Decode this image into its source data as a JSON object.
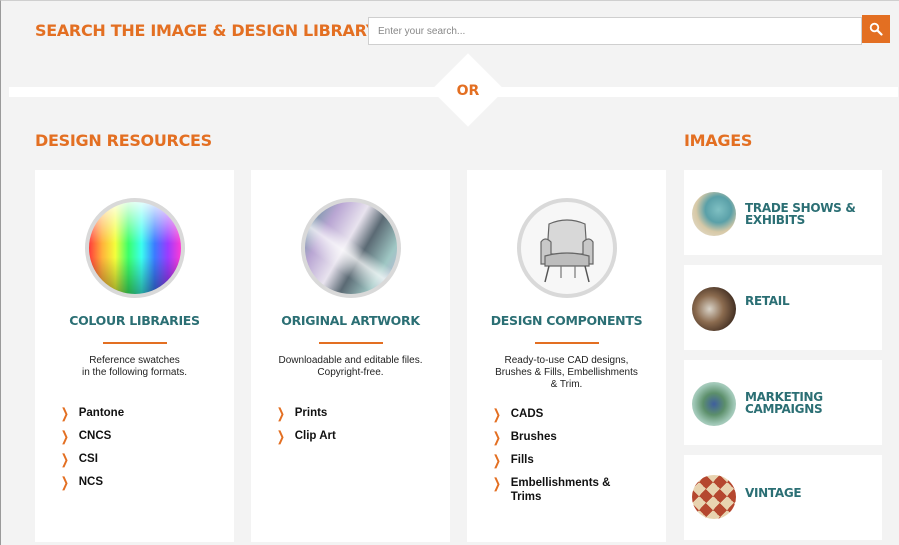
{
  "search": {
    "title": "SEARCH THE IMAGE & DESIGN LIBRARY",
    "placeholder": "Enter your search...",
    "button_icon": "search-icon"
  },
  "divider": {
    "label": "OR"
  },
  "design_resources": {
    "heading": "DESIGN RESOURCES",
    "cards": [
      {
        "title": "COLOUR LIBRARIES",
        "image": "colour-spectrum-image",
        "description": [
          "Reference swatches",
          "in the following formats."
        ],
        "links": [
          "Pantone",
          "CNCS",
          "CSI",
          "NCS"
        ]
      },
      {
        "title": "ORIGINAL ARTWORK",
        "image": "artwork-image",
        "description": [
          "Downloadable and editable files.",
          "Copyright-free."
        ],
        "links": [
          "Prints",
          "Clip Art"
        ]
      },
      {
        "title": "DESIGN COMPONENTS",
        "image": "armchair-sketch-image",
        "description": [
          "Ready-to-use CAD designs,",
          "Brushes & Fills, Embellishments",
          "& Trim."
        ],
        "links": [
          "CADS",
          "Brushes",
          "Fills",
          "Embellishments & Trims"
        ]
      }
    ]
  },
  "images": {
    "heading": "IMAGES",
    "items": [
      {
        "label": "TRADE SHOWS & EXHIBITS",
        "thumb": "trade-shows-thumbnail"
      },
      {
        "label": "RETAIL",
        "thumb": "retail-thumbnail"
      },
      {
        "label": "MARKETING CAMPAIGNS",
        "thumb": "marketing-thumbnail"
      },
      {
        "label": "VINTAGE",
        "thumb": "vintage-thumbnail"
      }
    ]
  },
  "colors": {
    "accent": "#e36f22",
    "heading_teal": "#2b6f74",
    "background": "#f3f3f3"
  }
}
